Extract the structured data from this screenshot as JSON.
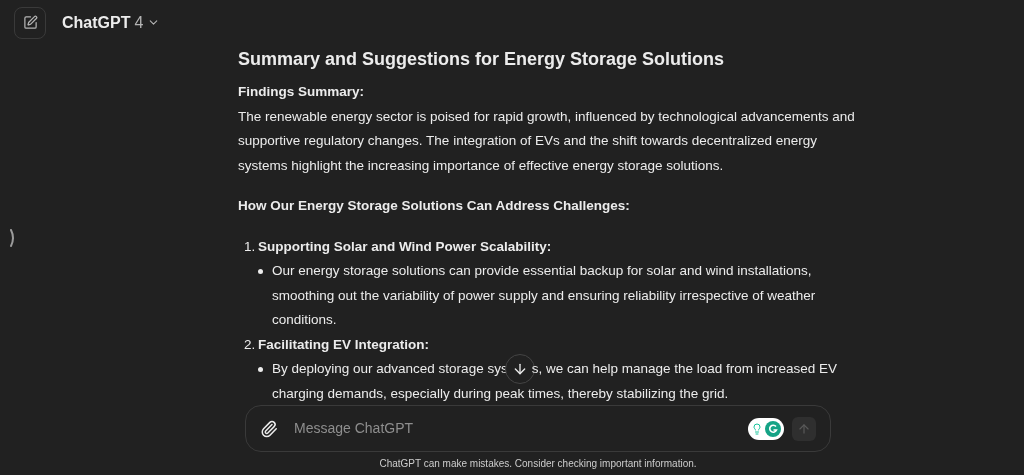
{
  "header": {
    "model": "ChatGPT",
    "version": "4"
  },
  "message": {
    "title": "Summary and Suggestions for Energy Storage Solutions",
    "blocks": [
      {
        "kind": "heading",
        "text": "Findings Summary:"
      },
      {
        "kind": "paragraph",
        "text": "The renewable energy sector is poised for rapid growth, influenced by technological advancements and supportive regulatory changes. The integration of EVs and the shift towards decentralized energy systems highlight the increasing importance of effective energy storage solutions."
      },
      {
        "kind": "heading",
        "text": "How Our Energy Storage Solutions Can Address Challenges:"
      },
      {
        "kind": "list",
        "items": [
          {
            "number": "1.",
            "title": "Supporting Solar and Wind Power Scalability:",
            "bullets": [
              "Our energy storage solutions can provide essential backup for solar and wind installations, smoothing out the variability of power supply and ensuring reliability irrespective of weather conditions."
            ]
          },
          {
            "number": "2.",
            "title": "Facilitating EV Integration:",
            "covered_bullet": {
              "before": "By deploying our advanced storage sys",
              "after": "s, we can help manage the load from increased EV",
              "rest": "charging demands, especially during peak times, thereby stabilizing the grid."
            }
          }
        ]
      }
    ]
  },
  "composer": {
    "placeholder": "Message ChatGPT"
  },
  "footer": "ChatGPT can make mistakes. Consider checking important information."
}
